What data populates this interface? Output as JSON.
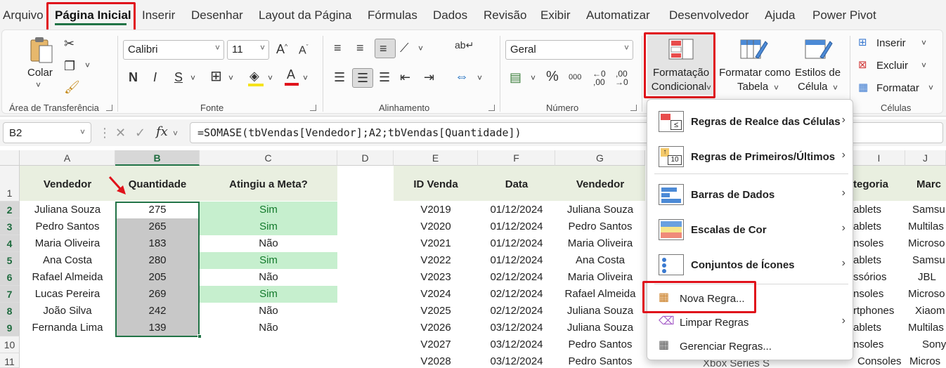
{
  "tabs": [
    "Arquivo",
    "Página Inicial",
    "Inserir",
    "Desenhar",
    "Layout da Página",
    "Fórmulas",
    "Dados",
    "Revisão",
    "Exibir",
    "Automatizar",
    "Desenvolvedor",
    "Ajuda",
    "Power Pivot"
  ],
  "ribbon": {
    "clipboard": {
      "paste": "Colar",
      "label": "Área de Transferência"
    },
    "font": {
      "name": "Calibri",
      "size": "11",
      "bold": "N",
      "italic": "I",
      "underline": "S",
      "label": "Fonte"
    },
    "alignment": {
      "label": "Alinhamento"
    },
    "number": {
      "format": "Geral",
      "label": "Número",
      "percent": "%",
      "thousands": "000"
    },
    "cond_format": {
      "line1": "Formatação",
      "line2": "Condicional"
    },
    "table_format": {
      "line1": "Formatar como",
      "line2": "Tabela"
    },
    "cell_styles": {
      "line1": "Estilos de",
      "line2": "Célula"
    },
    "cells": {
      "insert": "Inserir",
      "delete": "Excluir",
      "format": "Formatar",
      "label": "Células"
    }
  },
  "formula_bar": {
    "name_box": "B2",
    "fx": "fx",
    "formula": "=SOMASE(tbVendas[Vendedor];A2;tbVendas[Quantidade])"
  },
  "columns": [
    "A",
    "B",
    "C",
    "D",
    "E",
    "F",
    "G",
    "I",
    "J"
  ],
  "rows": [
    "1",
    "2",
    "3",
    "4",
    "5",
    "6",
    "7",
    "8",
    "9",
    "10",
    "11"
  ],
  "left_table": {
    "headers": [
      "Vendedor",
      "Quantidade",
      "Atingiu a Meta?"
    ],
    "rows": [
      [
        "Juliana Souza",
        "275",
        "Sim"
      ],
      [
        "Pedro Santos",
        "265",
        "Sim"
      ],
      [
        "Maria Oliveira",
        "183",
        "Não"
      ],
      [
        "Ana Costa",
        "280",
        "Sim"
      ],
      [
        "Rafael Almeida",
        "205",
        "Não"
      ],
      [
        "Lucas Pereira",
        "269",
        "Sim"
      ],
      [
        "João Silva",
        "242",
        "Não"
      ],
      [
        "Fernanda Lima",
        "139",
        "Não"
      ]
    ]
  },
  "right_table": {
    "headers": [
      "ID Venda",
      "Data",
      "Vendedor",
      "tegoria",
      "Marc"
    ],
    "rows": [
      [
        "V2019",
        "01/12/2024",
        "Juliana Souza",
        "ablets",
        "Samsu"
      ],
      [
        "V2020",
        "01/12/2024",
        "Pedro Santos",
        "ablets",
        "Multilas"
      ],
      [
        "V2021",
        "01/12/2024",
        "Maria Oliveira",
        "nsoles",
        "Microso"
      ],
      [
        "V2022",
        "01/12/2024",
        "Ana Costa",
        "ablets",
        "Samsu"
      ],
      [
        "V2023",
        "02/12/2024",
        "Maria Oliveira",
        "ssórios",
        "JBL"
      ],
      [
        "V2024",
        "02/12/2024",
        "Rafael Almeida",
        "nsoles",
        "Microso"
      ],
      [
        "V2025",
        "02/12/2024",
        "Juliana Souza",
        "rtphones",
        "Xiaom"
      ],
      [
        "V2026",
        "03/12/2024",
        "Juliana Souza",
        "ablets",
        "Multilas"
      ],
      [
        "V2027",
        "03/12/2024",
        "Pedro Santos",
        "nsoles",
        "Sony"
      ],
      [
        "V2028",
        "03/12/2024",
        "Pedro Santos",
        "Consoles",
        "Micros"
      ]
    ],
    "partial_product": "Xbox Series S"
  },
  "menu": {
    "items": [
      {
        "label": "Regras de Realce das Células",
        "submenu": true
      },
      {
        "label": "Regras de Primeiros/Últimos",
        "submenu": true
      },
      {
        "label": "Barras de Dados",
        "submenu": true
      },
      {
        "label": "Escalas de Cor",
        "submenu": true
      },
      {
        "label": "Conjuntos de Ícones",
        "submenu": true
      }
    ],
    "actions": [
      {
        "label": "Nova Regra...",
        "submenu": false
      },
      {
        "label": "Limpar Regras",
        "submenu": true
      },
      {
        "label": "Gerenciar Regras...",
        "submenu": false
      }
    ]
  },
  "colors": {
    "accent": "#217346",
    "highlight_red": "#e0121b",
    "meta_green_fill": "#c6efce",
    "meta_green_text": "#137a2c",
    "header_fill": "#e9efe0"
  }
}
